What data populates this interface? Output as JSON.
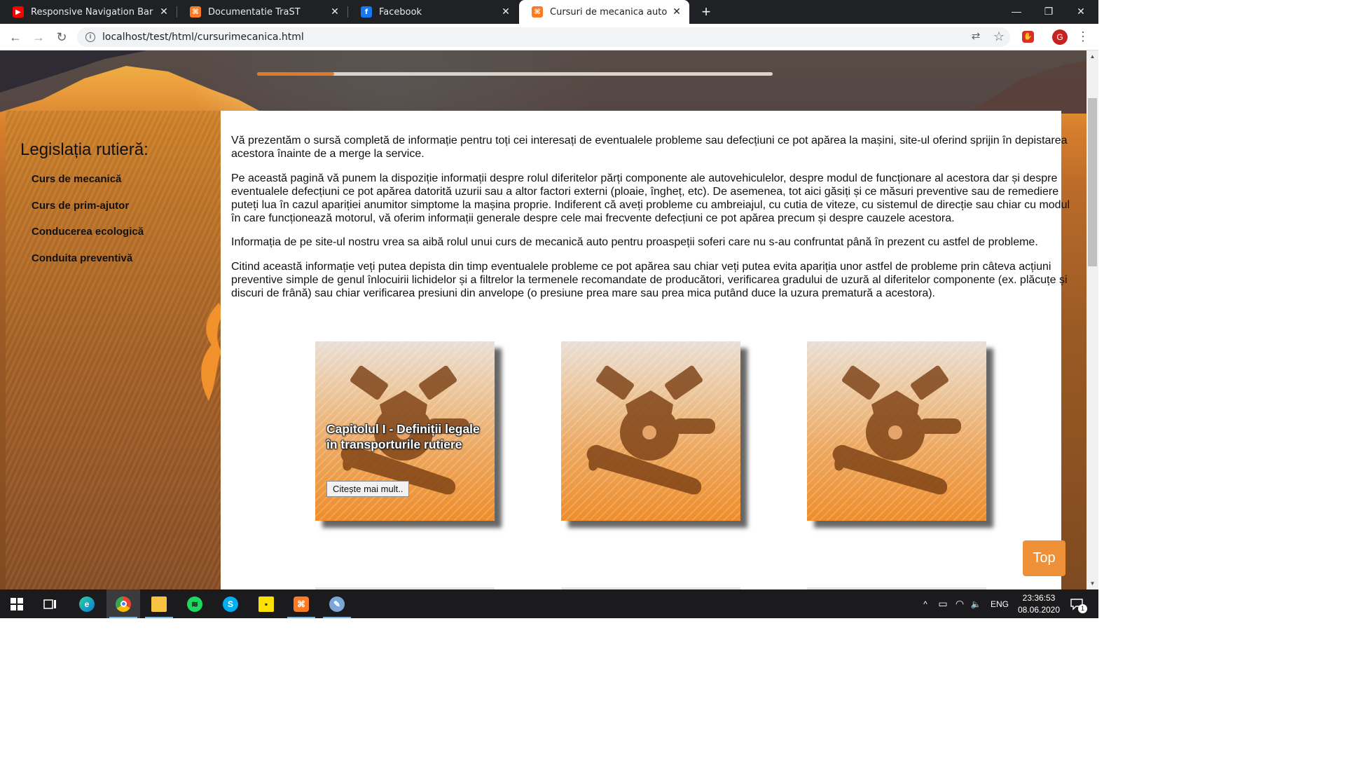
{
  "browser": {
    "tabs": [
      {
        "title": "Responsive Navigation Bar with HTM",
        "favicon": "youtube-icon",
        "favicon_color": "#ff0000"
      },
      {
        "title": "Documentatie TraST",
        "favicon": "xampp-icon",
        "favicon_color": "#fb7a24"
      },
      {
        "title": "Facebook",
        "favicon": "facebook-icon",
        "favicon_color": "#1877f2"
      },
      {
        "title": "Cursuri de mecanica auto",
        "favicon": "xampp-icon",
        "favicon_color": "#fb7a24",
        "active": true
      }
    ],
    "close_glyph": "✕",
    "new_tab_glyph": "+",
    "window_controls": {
      "minimize": "—",
      "restore": "❐",
      "close": "✕"
    },
    "nav": {
      "back": "←",
      "forward": "→",
      "reload": "↻"
    },
    "url": "localhost/test/html/cursurimecanica.html",
    "info_glyph": "i",
    "translate_glyph": "⇄",
    "bookmark_glyph": "☆",
    "adblock_glyph": "✋",
    "profile_initial": "G",
    "menu_glyph": "⋮"
  },
  "page": {
    "slider_progress": 0.15,
    "accent_color": "#e07a2a",
    "sidebar": {
      "title": "Legislația rutieră:",
      "links": [
        "Curs de mecanică",
        "Curs de prim-ajutor",
        "Conducerea ecologică",
        "Conduita preventivă"
      ]
    },
    "paragraphs": [
      "Vă prezentăm o sursă completă de informație pentru toți cei interesați de eventualele probleme sau defecțiuni ce pot apărea la mașini, site-ul oferind sprijin în depistarea acestora înainte de a merge la service.",
      "Pe această pagină vă punem la dispoziție informații despre rolul diferitelor părți componente ale autovehiculelor, despre modul de funcționare al acestora dar și despre eventualele defecțiuni ce pot apărea datorită uzurii sau a altor factori externi (ploaie, îngheț, etc). De asemenea, tot aici găsiți și ce măsuri preventive sau de remediere puteți lua în cazul apariției anumitor simptome la mașina proprie. Indiferent că aveți probleme cu ambreiajul, cu cutia de viteze, cu sistemul de direcție sau chiar cu modul în care funcționează motorul, vă oferim informații generale despre cele mai frecvente defecțiuni ce pot apărea precum și despre cauzele acestora.",
      "Informația de pe site-ul nostru vrea sa aibă rolul unui curs de mecanică auto pentru proaspeții soferi care nu s-au confruntat până în prezent cu astfel de probleme.",
      "Citind această informație veți putea depista din timp eventualele probleme ce pot apărea sau chiar veți putea evita apariția unor astfel de probleme prin câteva acțiuni preventive simple de genul înlocuirii lichidelor și a filtrelor la termenele recomandate de producători, verificarea gradului de uzură al diferitelor componente (ex. plăcuțe și discuri de frână) sau chiar verificarea presiuni din anvelope (o presiune prea mare sau prea mica putând duce la uzura prematură a acestora)."
    ],
    "cards": [
      {
        "icon": "engine-wrench-icon",
        "title": "Capitolul I - Definiții legale în transporturile rutiere",
        "button": "Citește mai mult.."
      },
      {
        "icon": "engine-wrench-icon",
        "title": "",
        "button": ""
      },
      {
        "icon": "engine-wrench-icon",
        "title": "",
        "button": ""
      }
    ],
    "top_button": "Top"
  },
  "taskbar": {
    "apps": [
      {
        "name": "start-icon"
      },
      {
        "name": "task-view-icon"
      },
      {
        "name": "edge-icon"
      },
      {
        "name": "chrome-icon",
        "active": true
      },
      {
        "name": "file-explorer-icon"
      },
      {
        "name": "spotify-icon"
      },
      {
        "name": "skype-icon"
      },
      {
        "name": "sticky-notes-icon"
      },
      {
        "name": "xampp-icon"
      },
      {
        "name": "paint-icon"
      }
    ],
    "tray": {
      "chevron": "^",
      "battery": "▭",
      "wifi": "◠",
      "volume": "🔈",
      "language": "ENG"
    },
    "time": "23:36:53",
    "date": "08.06.2020",
    "notification_count": "1"
  }
}
